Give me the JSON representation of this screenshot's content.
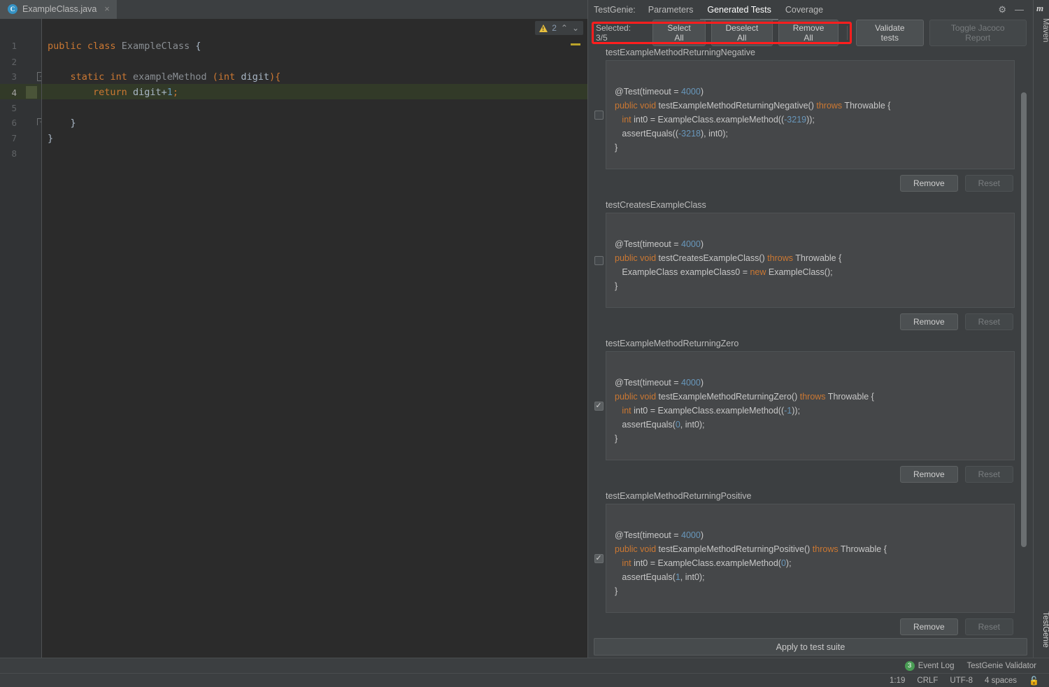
{
  "editor": {
    "tab": {
      "filename": "ExampleClass.java",
      "icon": "java-class-icon",
      "close": "×"
    },
    "line_numbers": [
      "1",
      "2",
      "3",
      "4",
      "5",
      "6",
      "7",
      "8"
    ],
    "code_lines": [
      {
        "n": 1,
        "plain": "public class ExampleClass {"
      },
      {
        "n": 2,
        "plain": ""
      },
      {
        "n": 3,
        "plain": "    static int exampleMethod (int digit){"
      },
      {
        "n": 4,
        "plain": "        return digit+1;"
      },
      {
        "n": 5,
        "plain": ""
      },
      {
        "n": 6,
        "plain": "    }"
      },
      {
        "n": 7,
        "plain": "}"
      },
      {
        "n": 8,
        "plain": ""
      }
    ],
    "inspection": {
      "warning_count": "2",
      "icon": "warning-triangle-icon",
      "up": "⌃",
      "down": "⌄"
    }
  },
  "testgenie": {
    "title": "TestGenie:",
    "tabs": [
      {
        "label": "Parameters",
        "active": false
      },
      {
        "label": "Generated Tests",
        "active": true
      },
      {
        "label": "Coverage",
        "active": false
      }
    ],
    "header_icons": [
      {
        "name": "gear-icon",
        "glyph": "⚙"
      },
      {
        "name": "minimize-icon",
        "glyph": "—"
      }
    ],
    "toolbar": {
      "selected_label": "Selected: 3/5",
      "select_all": "Select All",
      "deselect_all": "Deselect All",
      "remove_all": "Remove All",
      "validate_tests": "Validate tests",
      "toggle_jacoco": "Toggle Jacoco Report",
      "highlight_color": "#ff1e1e"
    },
    "apply_button": "Apply to test suite",
    "row_buttons": {
      "remove": "Remove",
      "reset": "Reset"
    },
    "tests": [
      {
        "name": "testExampleMethodReturningNegative",
        "checked": false,
        "code": [
          "",
          "@Test(timeout = <num>4000</num>)",
          "<kw>public void</kw> testExampleMethodReturningNegative() <kw>throws</kw> Throwable {",
          "   <kw>int</kw> int0 = ExampleClass.exampleMethod((<num>-3219</num>));",
          "   assertEquals((<num>-3218</num>), int0);",
          "}"
        ]
      },
      {
        "name": "testCreatesExampleClass",
        "checked": false,
        "code": [
          "",
          "@Test(timeout = <num>4000</num>)",
          "<kw>public void</kw> testCreatesExampleClass() <kw>throws</kw> Throwable {",
          "   ExampleClass exampleClass0 = <kw>new</kw> ExampleClass();",
          "}"
        ]
      },
      {
        "name": "testExampleMethodReturningZero",
        "checked": true,
        "code": [
          "",
          "@Test(timeout = <num>4000</num>)",
          "<kw>public void</kw> testExampleMethodReturningZero() <kw>throws</kw> Throwable {",
          "   <kw>int</kw> int0 = ExampleClass.exampleMethod((<num>-1</num>));",
          "   assertEquals(<num>0</num>, int0);",
          "}"
        ]
      },
      {
        "name": "testExampleMethodReturningPositive",
        "checked": true,
        "code": [
          "",
          "@Test(timeout = <num>4000</num>)",
          "<kw>public void</kw> testExampleMethodReturningPositive() <kw>throws</kw> Throwable {",
          "   <kw>int</kw> int0 = ExampleClass.exampleMethod(<num>0</num>);",
          "   assertEquals(<num>1</num>, int0);",
          "}"
        ]
      }
    ]
  },
  "right_stripe": {
    "maven_icon": "m",
    "maven_label": "Maven",
    "testgenie_label": "TestGenie"
  },
  "status_bar": {
    "event_log_badge": "3",
    "event_log": "Event Log",
    "validator": "TestGenie Validator",
    "caret_position": "1:19",
    "line_separator": "CRLF",
    "encoding": "UTF-8",
    "indent": "4 spaces",
    "lock_icon": "🔓"
  }
}
